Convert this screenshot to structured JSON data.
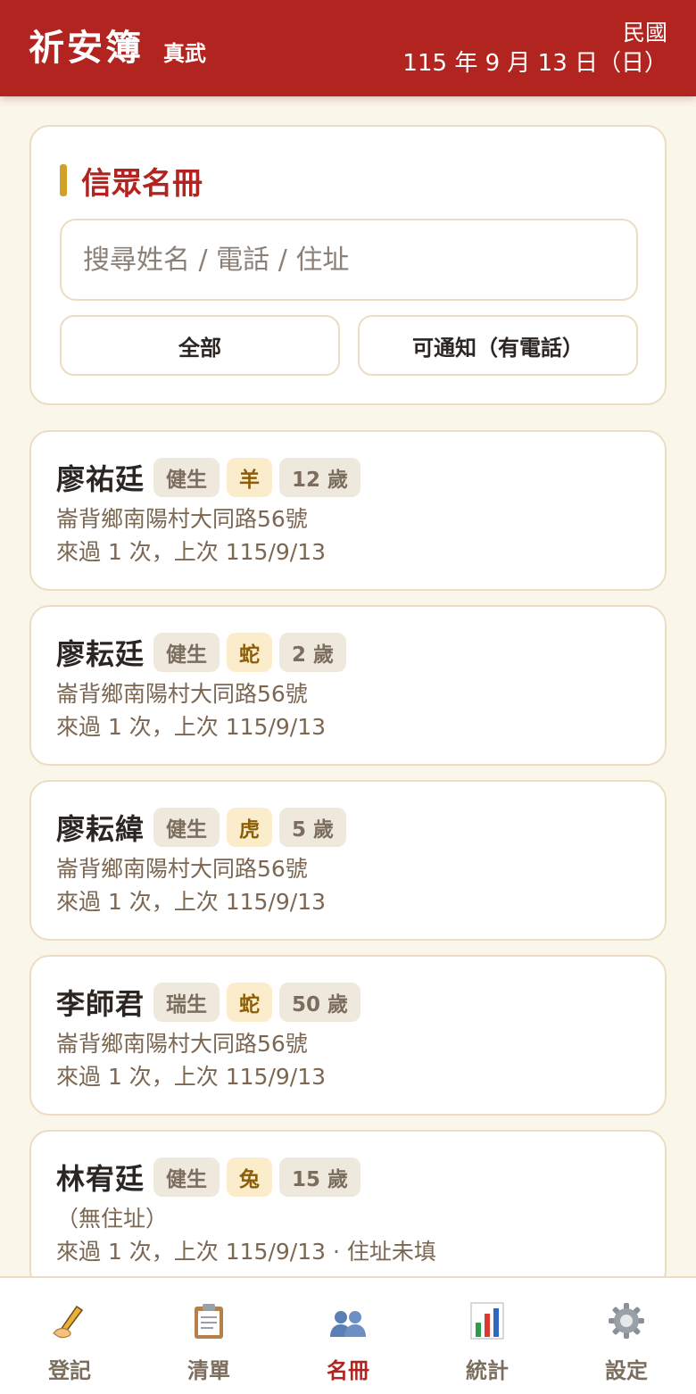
{
  "header": {
    "brand": "祈安簿",
    "temple": "真武",
    "era": "民國",
    "date": "115 年 9 月 13 日（日）"
  },
  "section": {
    "title": "信眾名冊",
    "search_placeholder": "搜尋姓名 / 電話 / 住址",
    "filters": [
      "全部",
      "可通知（有電話）"
    ]
  },
  "members": [
    {
      "name": "廖祐廷",
      "blessing": "健生",
      "zodiac": "羊",
      "age": "12 歲",
      "address": "崙背鄉南陽村大同路56號",
      "visits": "來過 1 次，上次 115/9/13"
    },
    {
      "name": "廖耘廷",
      "blessing": "健生",
      "zodiac": "蛇",
      "age": "2 歲",
      "address": "崙背鄉南陽村大同路56號",
      "visits": "來過 1 次，上次 115/9/13"
    },
    {
      "name": "廖耘緯",
      "blessing": "健生",
      "zodiac": "虎",
      "age": "5 歲",
      "address": "崙背鄉南陽村大同路56號",
      "visits": "來過 1 次，上次 115/9/13"
    },
    {
      "name": "李師君",
      "blessing": "瑞生",
      "zodiac": "蛇",
      "age": "50 歲",
      "address": "崙背鄉南陽村大同路56號",
      "visits": "來過 1 次，上次 115/9/13"
    },
    {
      "name": "林宥廷",
      "blessing": "健生",
      "zodiac": "兔",
      "age": "15 歲",
      "address": "（無住址）",
      "visits": "來過 1 次，上次 115/9/13 · 住址未填"
    }
  ],
  "nav": {
    "items": [
      {
        "label": "登記",
        "icon": "writing-hand-icon"
      },
      {
        "label": "清單",
        "icon": "clipboard-icon"
      },
      {
        "label": "名冊",
        "icon": "people-icon"
      },
      {
        "label": "統計",
        "icon": "bar-chart-icon"
      },
      {
        "label": "設定",
        "icon": "gear-icon"
      }
    ],
    "active": "名冊"
  },
  "colors": {
    "primary": "#b2241f",
    "accent": "#d2a12a",
    "background": "#fbf6ea"
  }
}
